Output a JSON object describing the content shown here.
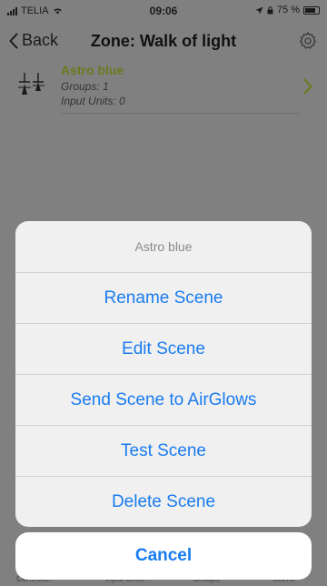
{
  "status_bar": {
    "carrier": "TELIA",
    "time": "09:06",
    "battery_text": "75 %",
    "battery_level": 0.75
  },
  "nav": {
    "back_label": "Back",
    "title": "Zone: Walk of light"
  },
  "scene_row": {
    "name": "Astro blue",
    "groups": "Groups: 1",
    "input_units": "Input Units: 0"
  },
  "action_sheet": {
    "title": "Astro blue",
    "actions": [
      "Rename Scene",
      "Edit Scene",
      "Send Scene to AirGlows",
      "Test Scene",
      "Delete Scene"
    ],
    "cancel": "Cancel"
  },
  "tab_bar": {
    "tabs": [
      "Controller",
      "Input Units",
      "Groups",
      "Scene"
    ]
  },
  "colors": {
    "dim_background": "#808080",
    "accent_blue": "#1a7cf0",
    "scene_name_olive": "#6b7a1e"
  }
}
